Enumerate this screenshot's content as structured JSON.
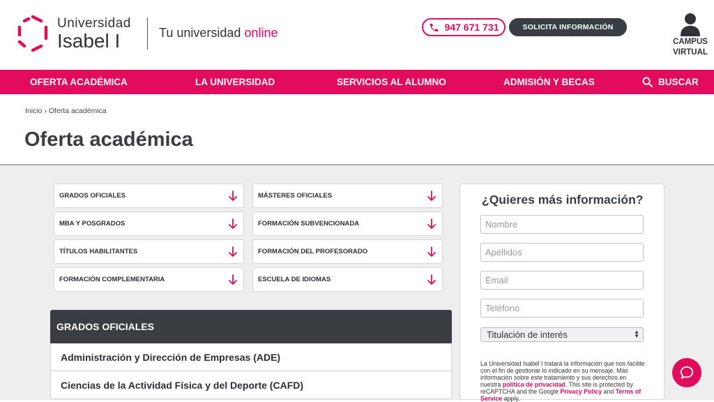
{
  "brand": {
    "name_line1": "Universidad",
    "name_line2": "Isabel I",
    "tagline": "Tu universidad",
    "tagline_accent": "online",
    "accent_color": "#e30b5c",
    "dark_color": "#3a3d42"
  },
  "header": {
    "phone": "947 671 731",
    "solicita_label": "SOLICITA INFORMACIÓN",
    "campus_line1": "CAMPUS",
    "campus_line2": "VIRTUAL"
  },
  "nav": {
    "items": [
      "OFERTA ACADÉMICA",
      "LA UNIVERSIDAD",
      "SERVICIOS AL ALUMNO",
      "ADMISIÓN Y BECAS"
    ],
    "search_label": "BUSCAR"
  },
  "breadcrumb": "Inicio › Oferta académica",
  "page_title": "Oferta académica",
  "categories": [
    "GRADOS OFICIALES",
    "MÁSTERES OFICIALES",
    "MBA Y POSGRADOS",
    "FORMACIÓN SUBVENCIONADA",
    "TÍTULOS HABILITANTES",
    "FORMACIÓN DEL PROFESORADO",
    "FORMACIÓN COMPLEMENTARIA",
    "ESCUELA DE IDIOMAS"
  ],
  "list": {
    "header": "GRADOS OFICIALES",
    "items": [
      "Administración y Dirección de Empresas (ADE)",
      "Ciencias de la Actividad Física y del Deporte (CAFD)"
    ]
  },
  "form": {
    "title": "¿Quieres más información?",
    "placeholders": {
      "nombre": "Nombre",
      "apellidos": "Apellidos",
      "email": "Email",
      "telefono": "Teléfono"
    },
    "select_value": "Titulación de interés",
    "legal_1": "La Universidad Isabel I tratará la información que nos facilite con el fin de gestionar lo indicado en su mensaje. Más información sobre este tratamiento y sus derechos en nuestra ",
    "legal_privacy_link": "política de privacidad",
    "legal_2": ". This site is protected by reCAPTCHA and the Google ",
    "legal_google_privacy": "Privacy Policy",
    "legal_3": " and ",
    "legal_terms": "Terms of Service",
    "legal_4": " apply."
  },
  "icons": {
    "phone": "phone-icon",
    "user": "user-icon",
    "search": "search-icon",
    "arrow": "arrow-down-icon",
    "chat": "chat-icon"
  }
}
